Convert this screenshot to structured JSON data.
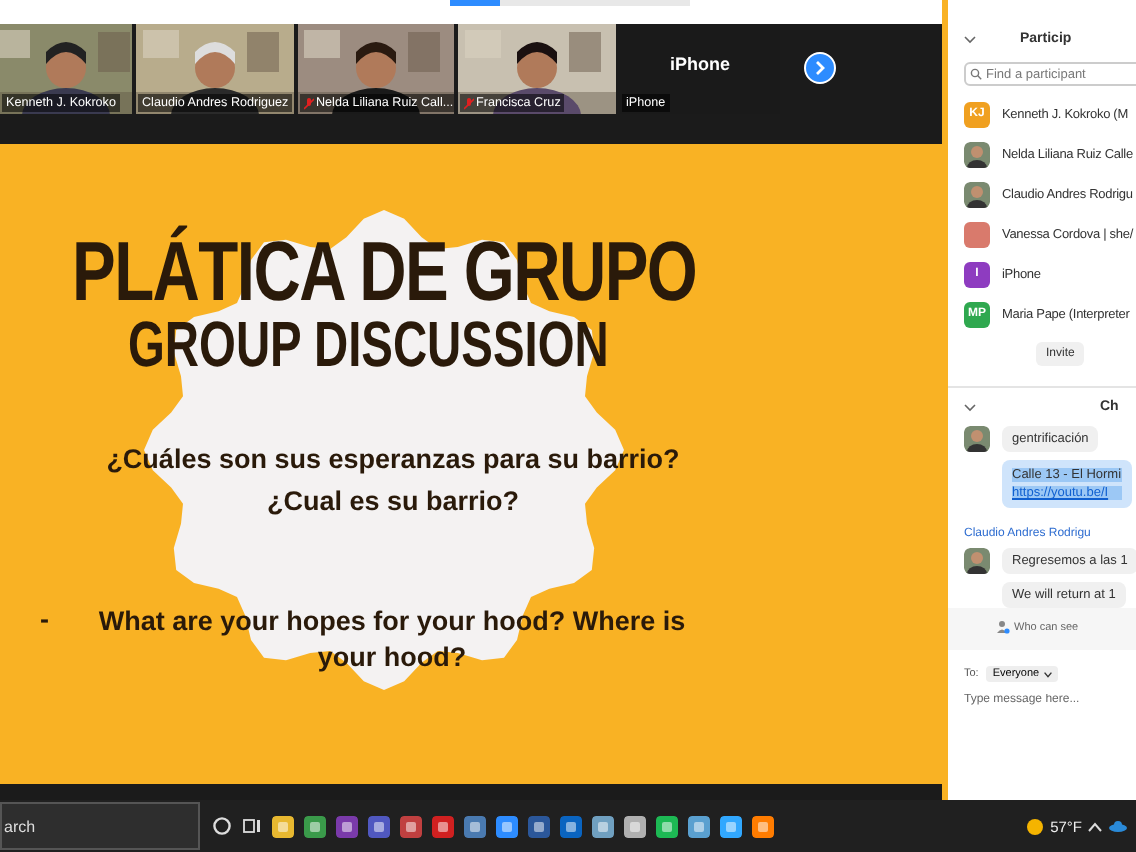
{
  "video_strip": {
    "tiles": [
      {
        "kind": "video",
        "label": "Kenneth J. Kokroko",
        "muted": false
      },
      {
        "kind": "video",
        "label": "Claudio Andres Rodriguez",
        "muted": false
      },
      {
        "kind": "video",
        "label": "Nelda Liliana Ruiz Call...",
        "muted": true
      },
      {
        "kind": "video",
        "label": "Francisca Cruz",
        "muted": true
      },
      {
        "kind": "avatar",
        "name": "iPhone",
        "label": "iPhone",
        "muted": false
      }
    ]
  },
  "slide": {
    "title": "PLÁTICA DE GRUPO",
    "subtitle": "GROUP DISCUSSION",
    "questions": [
      "¿Cuáles son sus esperanzas para su barrio?",
      "¿Cual es su barrio?"
    ],
    "bullet": {
      "marker": "-",
      "text": "What are your hopes for your hood? Where is your hood?"
    }
  },
  "participants": {
    "title": "Particip",
    "search": {
      "placeholder": "Find a participant"
    },
    "items": [
      {
        "kind": "initials",
        "initials": "KJ",
        "color": "#f0a020",
        "name": "Kenneth J. Kokroko (M"
      },
      {
        "name": "Nelda Liliana Ruiz Calle"
      },
      {
        "name": "Claudio Andres Rodrigu"
      },
      {
        "kind": "plain",
        "color": "#d97a6c",
        "name": "Vanessa Cordova | she/"
      },
      {
        "kind": "initials",
        "initials": "I",
        "color": "#8e3cc0",
        "name": "iPhone"
      },
      {
        "kind": "initials",
        "initials": "MP",
        "color": "#2fa84f",
        "name": "Maria Pape (Interpreter"
      }
    ],
    "invite": "Invite"
  },
  "chat": {
    "title": "Ch",
    "groups": [
      {
        "messages": [
          {
            "kind": "text",
            "text": "gentrificación"
          },
          {
            "kind": "link",
            "text": "Calle 13 - El Hormi",
            "url": "https://youtu.be/I"
          }
        ]
      },
      {
        "sender": "Claudio Andres Rodrigu",
        "messages": [
          {
            "kind": "text",
            "text": "Regresemos a las 1"
          },
          {
            "kind": "text",
            "text": "We will return at 1"
          }
        ]
      }
    ],
    "who_can_see": "Who can see",
    "to_label": "To:",
    "recipient": "Everyone",
    "placeholder": "Type message here..."
  },
  "taskbar": {
    "search": "arch",
    "weather": "57°F"
  }
}
